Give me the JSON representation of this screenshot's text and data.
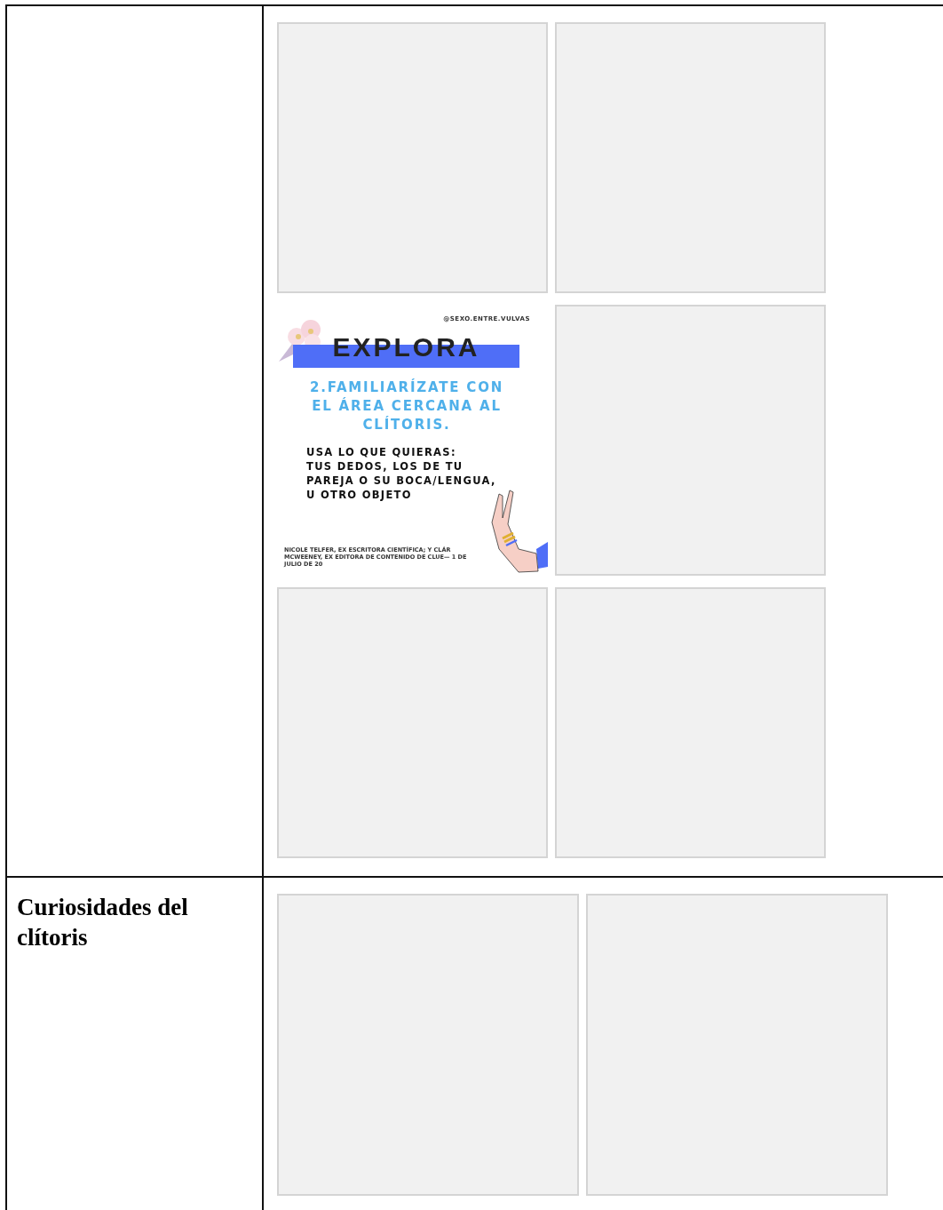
{
  "table": {
    "rows": [
      {
        "images": [
          {
            "kind": "placeholder"
          },
          {
            "kind": "placeholder"
          },
          {
            "kind": "infographic",
            "handle": "@SEXO.ENTRE.VULVAS",
            "title": "EXPLORA",
            "subtitle_lines": [
              "2.FAMILIARÍZATE CON",
              "EL ÁREA CERCANA AL",
              "CLÍTORIS."
            ],
            "body_lines": [
              "USA LO QUE QUIERAS:",
              "TUS DEDOS, LOS DE TU",
              "PAREJA O SU BOCA/LENGUA,",
              "U OTRO OBJETO"
            ],
            "credit": "NICOLE TELFER, EX ESCRITORA CIENTÍFICA; Y CLÁR MCWEENEY, EX EDITORA DE CONTENIDO DE CLUE— 1 DE JULIO DE 20"
          },
          {
            "kind": "placeholder"
          },
          {
            "kind": "placeholder"
          },
          {
            "kind": "placeholder"
          }
        ]
      },
      {
        "heading": "Curiosidades del clítoris",
        "images": [
          {
            "kind": "placeholder"
          },
          {
            "kind": "placeholder"
          }
        ]
      }
    ]
  }
}
